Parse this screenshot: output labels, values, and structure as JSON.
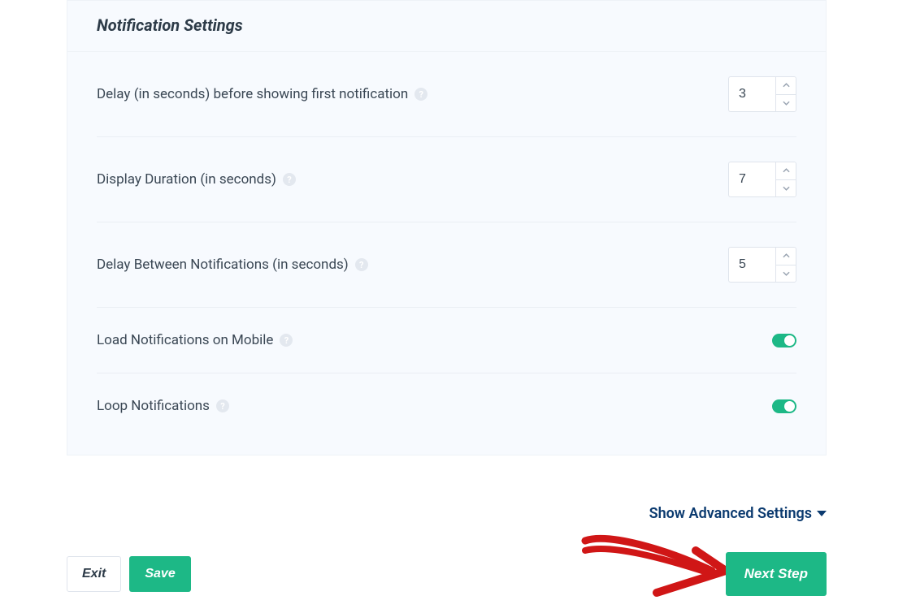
{
  "panel": {
    "title": "Notification Settings",
    "rows": [
      {
        "label": "Delay (in seconds) before showing first notification",
        "value": "3",
        "type": "number"
      },
      {
        "label": "Display Duration (in seconds)",
        "value": "7",
        "type": "number"
      },
      {
        "label": "Delay Between Notifications (in seconds)",
        "value": "5",
        "type": "number"
      },
      {
        "label": "Load Notifications on Mobile",
        "value": true,
        "type": "toggle"
      },
      {
        "label": "Loop Notifications",
        "value": true,
        "type": "toggle"
      }
    ]
  },
  "advanced_link": "Show Advanced Settings",
  "buttons": {
    "exit": "Exit",
    "save": "Save",
    "next": "Next Step"
  },
  "colors": {
    "accent": "#1db886",
    "link": "#0b3a6f",
    "panel_bg": "#f7fafe"
  }
}
